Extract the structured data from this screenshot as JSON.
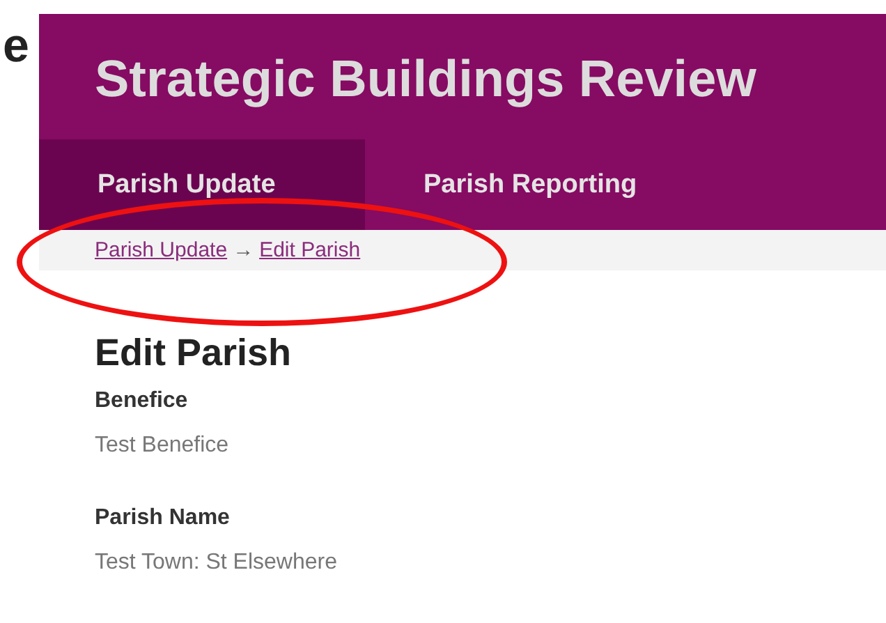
{
  "edge_fragment": "e",
  "site_title": "Strategic Buildings Review",
  "tabs": [
    {
      "label": "Parish Update",
      "selected": true
    },
    {
      "label": "Parish Reporting",
      "selected": false
    }
  ],
  "breadcrumb": {
    "links": [
      "Parish Update",
      "Edit Parish"
    ],
    "separator": "→"
  },
  "annotation": {
    "kind": "ellipse",
    "color": "#ee1111"
  },
  "page_heading": "Edit Parish",
  "fields": [
    {
      "label": "Benefice",
      "value": "Test Benefice"
    },
    {
      "label": "Parish Name",
      "value": "Test Town: St Elsewhere"
    }
  ]
}
